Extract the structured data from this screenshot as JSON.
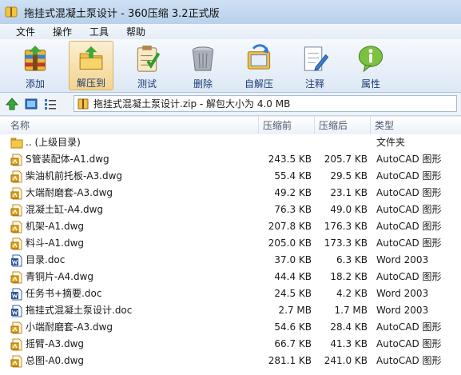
{
  "window": {
    "title": "拖挂式混凝土泵设计 - 360压缩 3.2正式版"
  },
  "menu": [
    "文件",
    "操作",
    "工具",
    "帮助"
  ],
  "toolbar": [
    {
      "label": "添加",
      "icon": "add-archive-icon",
      "active": false
    },
    {
      "label": "解压到",
      "icon": "extract-to-icon",
      "active": true
    },
    {
      "label": "测试",
      "icon": "test-clipboard-icon",
      "active": false
    },
    {
      "label": "删除",
      "icon": "trash-can-icon",
      "active": false
    },
    {
      "label": "自解压",
      "icon": "self-extract-icon",
      "active": false
    },
    {
      "label": "注释",
      "icon": "comment-pen-icon",
      "active": false
    },
    {
      "label": "属性",
      "icon": "info-bubble-icon",
      "active": false
    }
  ],
  "address": {
    "path": "拖挂式混凝土泵设计.zip - 解包大小为 4.0 MB"
  },
  "columns": {
    "name": "名称",
    "packed": "压缩前",
    "orig": "压缩后",
    "type": "类型"
  },
  "files": [
    {
      "name": ".. (上级目录)",
      "packed": "",
      "orig": "",
      "type": "文件夹",
      "icon": "folder-icon"
    },
    {
      "name": "S管装配体-A1.dwg",
      "packed": "243.5 KB",
      "orig": "205.7 KB",
      "type": "AutoCAD 图形",
      "icon": "dwg-file-icon"
    },
    {
      "name": "柴油机前托板-A3.dwg",
      "packed": "55.4 KB",
      "orig": "29.5 KB",
      "type": "AutoCAD 图形",
      "icon": "dwg-file-icon"
    },
    {
      "name": "大端耐磨套-A3.dwg",
      "packed": "49.2 KB",
      "orig": "23.1 KB",
      "type": "AutoCAD 图形",
      "icon": "dwg-file-icon"
    },
    {
      "name": "混凝土缸-A4.dwg",
      "packed": "76.3 KB",
      "orig": "49.0 KB",
      "type": "AutoCAD 图形",
      "icon": "dwg-file-icon"
    },
    {
      "name": "机架-A1.dwg",
      "packed": "207.8 KB",
      "orig": "176.3 KB",
      "type": "AutoCAD 图形",
      "icon": "dwg-file-icon"
    },
    {
      "name": "料斗-A1.dwg",
      "packed": "205.0 KB",
      "orig": "173.3 KB",
      "type": "AutoCAD 图形",
      "icon": "dwg-file-icon"
    },
    {
      "name": "目录.doc",
      "packed": "37.0 KB",
      "orig": "6.3 KB",
      "type": "Word 2003",
      "icon": "word-file-icon"
    },
    {
      "name": "青铜片-A4.dwg",
      "packed": "44.4 KB",
      "orig": "18.2 KB",
      "type": "AutoCAD 图形",
      "icon": "dwg-file-icon"
    },
    {
      "name": "任务书+摘要.doc",
      "packed": "24.5 KB",
      "orig": "4.2 KB",
      "type": "Word 2003",
      "icon": "word-file-icon"
    },
    {
      "name": "拖挂式混凝土泵设计.doc",
      "packed": "2.7 MB",
      "orig": "1.7 MB",
      "type": "Word 2003",
      "icon": "word-file-icon"
    },
    {
      "name": "小端耐磨套-A3.dwg",
      "packed": "54.6 KB",
      "orig": "28.4 KB",
      "type": "AutoCAD 图形",
      "icon": "dwg-file-icon"
    },
    {
      "name": "摇臂-A3.dwg",
      "packed": "66.7 KB",
      "orig": "41.3 KB",
      "type": "AutoCAD 图形",
      "icon": "dwg-file-icon"
    },
    {
      "name": "总图-A0.dwg",
      "packed": "281.1 KB",
      "orig": "241.0 KB",
      "type": "AutoCAD 图形",
      "icon": "dwg-file-icon"
    }
  ]
}
